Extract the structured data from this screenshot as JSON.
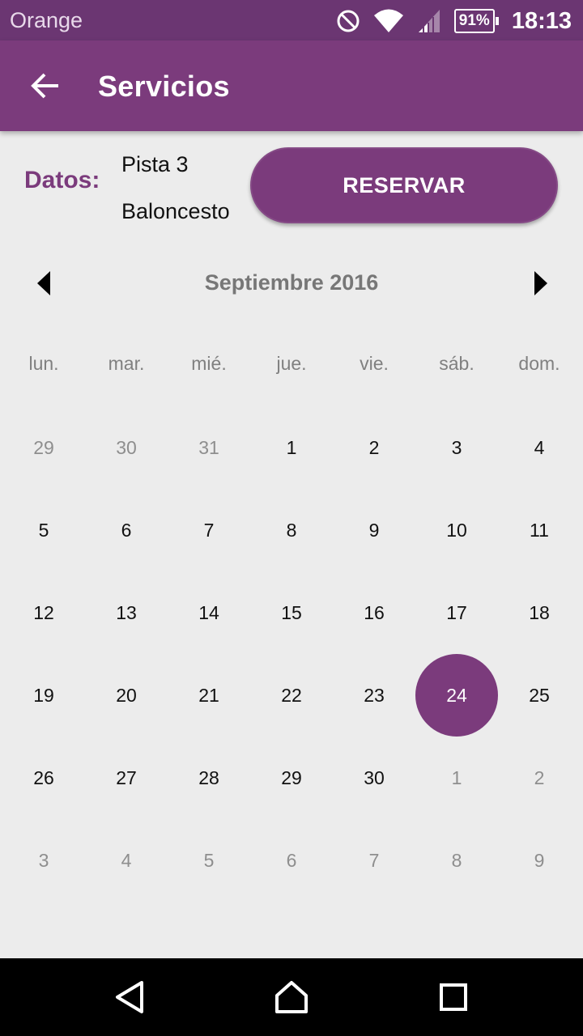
{
  "status_bar": {
    "carrier": "Orange",
    "battery": "91%",
    "time": "18:13",
    "icons": [
      "do-not-disturb-icon",
      "wifi-icon",
      "cell-signal-icon",
      "battery-icon"
    ]
  },
  "app_bar": {
    "title": "Servicios",
    "back_icon": "arrow-back-icon",
    "color": "#7b3b7c"
  },
  "datos": {
    "label": "Datos:",
    "line1": "Pista 3",
    "line2": "Baloncesto"
  },
  "reserve_button": {
    "label": "RESERVAR"
  },
  "calendar": {
    "title": "Septiembre 2016",
    "prev_icon": "triangle-left-icon",
    "next_icon": "triangle-right-icon",
    "weekdays": [
      "lun.",
      "mar.",
      "mié.",
      "jue.",
      "vie.",
      "sáb.",
      "dom."
    ],
    "selected_day": "24",
    "weeks": [
      [
        {
          "d": "29",
          "m": true
        },
        {
          "d": "30",
          "m": true
        },
        {
          "d": "31",
          "m": true
        },
        {
          "d": "1"
        },
        {
          "d": "2"
        },
        {
          "d": "3"
        },
        {
          "d": "4"
        }
      ],
      [
        {
          "d": "5"
        },
        {
          "d": "6"
        },
        {
          "d": "7"
        },
        {
          "d": "8"
        },
        {
          "d": "9"
        },
        {
          "d": "10"
        },
        {
          "d": "11"
        }
      ],
      [
        {
          "d": "12"
        },
        {
          "d": "13"
        },
        {
          "d": "14"
        },
        {
          "d": "15"
        },
        {
          "d": "16"
        },
        {
          "d": "17"
        },
        {
          "d": "18"
        }
      ],
      [
        {
          "d": "19"
        },
        {
          "d": "20"
        },
        {
          "d": "21"
        },
        {
          "d": "22"
        },
        {
          "d": "23"
        },
        {
          "d": "24",
          "s": true
        },
        {
          "d": "25"
        }
      ],
      [
        {
          "d": "26"
        },
        {
          "d": "27"
        },
        {
          "d": "28"
        },
        {
          "d": "29"
        },
        {
          "d": "30"
        },
        {
          "d": "1",
          "m": true
        },
        {
          "d": "2",
          "m": true
        }
      ],
      [
        {
          "d": "3",
          "m": true
        },
        {
          "d": "4",
          "m": true
        },
        {
          "d": "5",
          "m": true
        },
        {
          "d": "6",
          "m": true
        },
        {
          "d": "7",
          "m": true
        },
        {
          "d": "8",
          "m": true
        },
        {
          "d": "9",
          "m": true
        }
      ]
    ]
  },
  "nav_bar": {
    "icons": [
      "nav-back-icon",
      "nav-home-icon",
      "nav-recents-icon"
    ]
  }
}
